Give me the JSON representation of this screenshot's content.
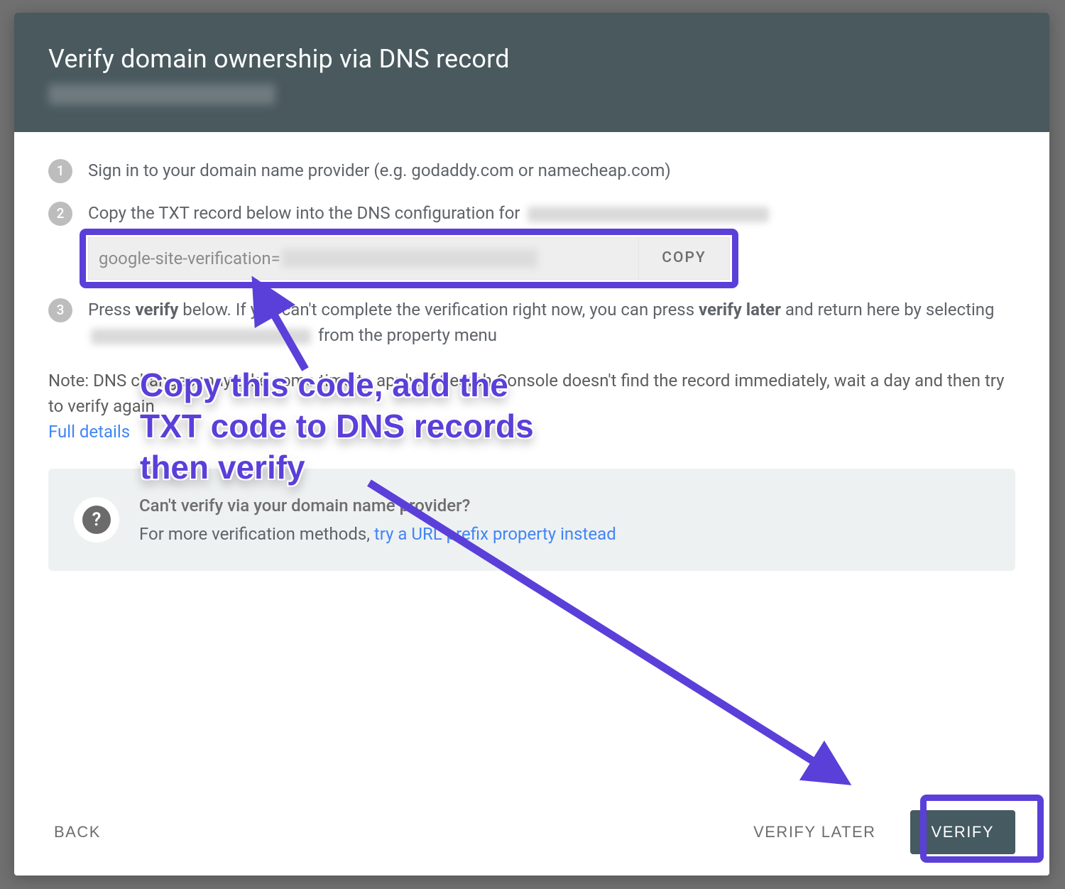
{
  "header": {
    "title": "Verify domain ownership via DNS record"
  },
  "steps": {
    "s1": {
      "num": "1",
      "text": "Sign in to your domain name provider (e.g. godaddy.com or namecheap.com)"
    },
    "s2": {
      "num": "2",
      "prefix": "Copy the TXT record below into the DNS configuration for ",
      "txt_prefix": "google-site-verification=",
      "copy_label": "COPY"
    },
    "s3": {
      "num": "3",
      "t_a": "Press ",
      "t_b": "verify",
      "t_c": " below. If you can't complete the verification right now, you can press ",
      "t_d": "verify later",
      "t_e": " and return here by selecting ",
      "t_f": " from the property menu"
    }
  },
  "note": {
    "prefix": "Note: DNS changes may take some time to apply. If Search Console doesn't find the record immediately, wait a day and then try to verify again",
    "link": "Full details"
  },
  "help": {
    "title": "Can't verify via your domain name provider?",
    "text": "For more verification methods, ",
    "link": "try a URL prefix property instead"
  },
  "footer": {
    "back": "BACK",
    "later": "VERIFY LATER",
    "verify": "VERIFY"
  },
  "annotation": {
    "l1": "Copy this code, add the",
    "l2": "TXT code to DNS records",
    "l3": "then verify"
  }
}
